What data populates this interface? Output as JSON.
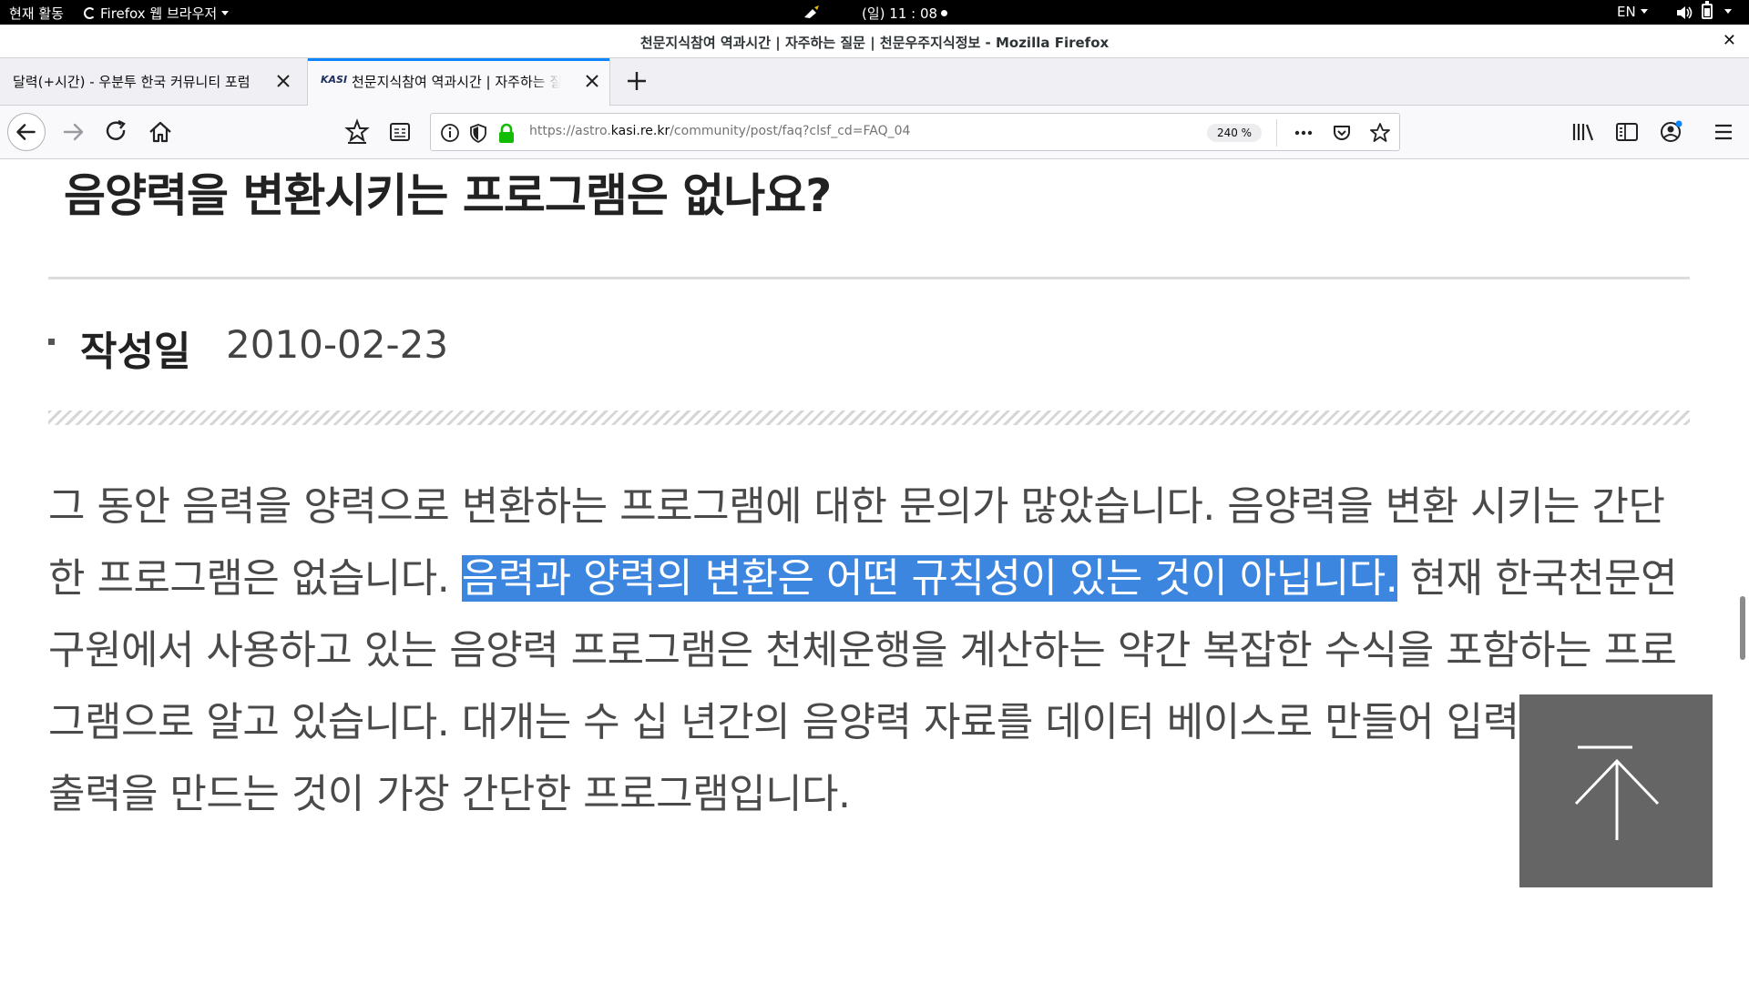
{
  "topbar": {
    "activities": "현재 활동",
    "app_menu": "Firefox 웹 브라우저",
    "clock": "(일) 11 : 08",
    "language": "EN"
  },
  "window": {
    "title": "천문지식참여 역과시간 | 자주하는 질문 | 천문우주지식정보 - Mozilla Firefox"
  },
  "tabs": [
    {
      "label": "달력(+시간) - 우분투 한국 커뮤니티 포럼",
      "active": false
    },
    {
      "label": "천문지식참여 역과시간 | 자주하는 질문 | 천문우주지식정보",
      "active": true,
      "favicon": "KASI"
    }
  ],
  "navbar": {
    "url_prefix": "https://astro.",
    "url_host": "kasi.re.kr",
    "url_path": "/community/post/faq?clsf_cd=FAQ_04",
    "zoom": "240 %"
  },
  "page": {
    "question_title": "음양력을 변환시키는 프로그램은 없나요?",
    "date_label": "작성일",
    "date_value": "2010-02-23",
    "answer_part1": "그 동안 음력을 양력으로 변환하는 프로그램에 대한 문의가 많았습니다. 음양력을 변환 시키는 간단한 프로그램은 없습니다. ",
    "answer_selected": "음력과 양력의 변환은 어떤 규칙성이 있는 것이 아닙니다.",
    "answer_part2": " 현재 한국천문연구원에서 사용하고 있는 음양력 프로그램은 천체운행을 계산하는 약간 복잡한 수식을 포함하는 프로그램으로 알고 있습니다. 대개는 수 십 년간의 음양력 자료를 데이터 베이스로 만들어 입력에 대한 출력을 만드는 것이 가장 간단한 프로그램입니다."
  },
  "colors": {
    "selection": "#3d86e0",
    "tab_accent": "#0a84ff",
    "lock_green": "#12bc00",
    "to_top_button": "#656565"
  },
  "icons": [
    "back-arrow-icon",
    "forward-arrow-icon",
    "reload-icon",
    "home-icon",
    "star-list-icon",
    "reader-view-icon",
    "info-icon",
    "shield-icon",
    "lock-icon",
    "more-icon",
    "pocket-icon",
    "bookmark-star-icon",
    "library-icon",
    "sidebar-icon",
    "account-icon",
    "hamburger-menu-icon",
    "arrow-up-icon"
  ]
}
